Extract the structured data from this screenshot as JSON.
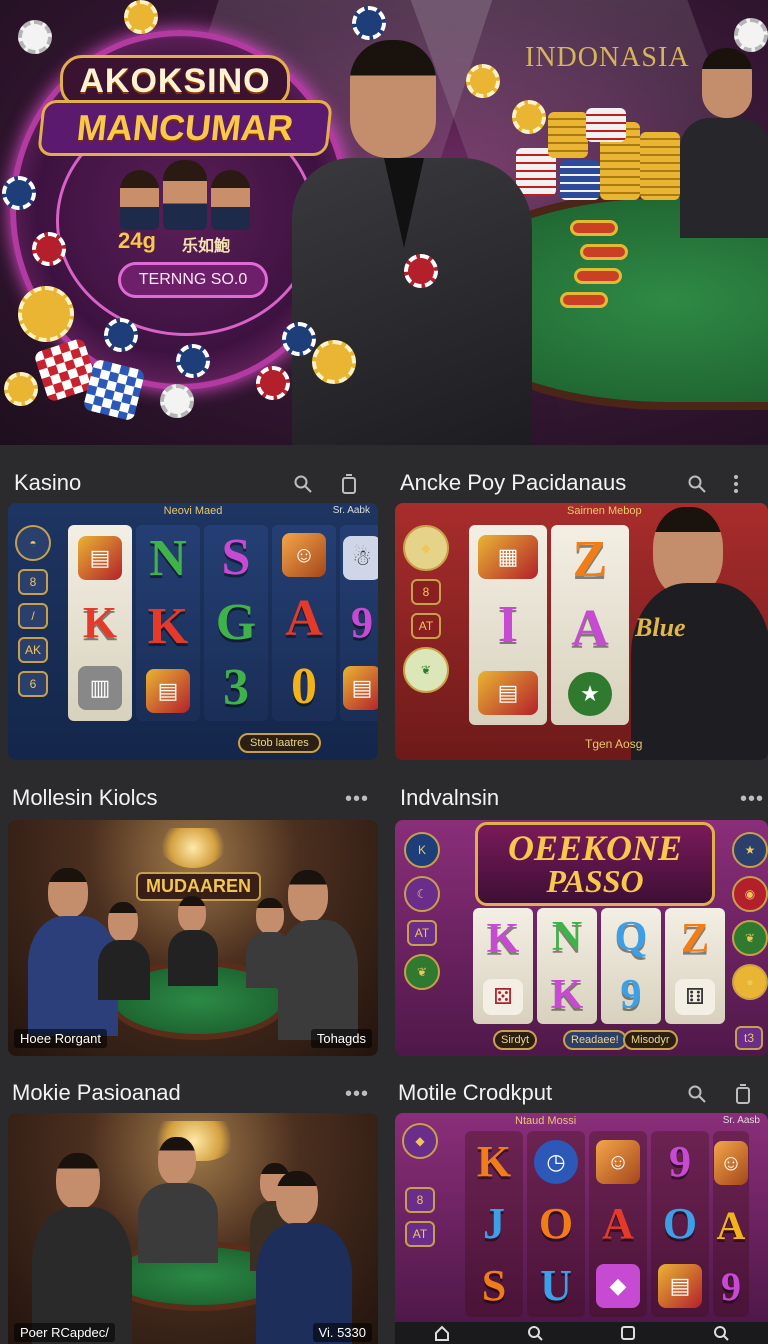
{
  "hero": {
    "logo_line1": "AKOKSINO",
    "logo_line2": "MANCUMAR",
    "number": "24g",
    "subtitle": "乐如鮑",
    "button_label": "TERNNG SO.0",
    "country_label": "INDONASIA"
  },
  "sections": [
    {
      "title": "Kasino",
      "card": {
        "topbar": "Neovi Maed",
        "topright": "Sr. Aabk",
        "pill": "Stob laatres"
      }
    },
    {
      "title": "Ancke Poy Pacidanaus",
      "card": {
        "topbar": "Sairnen Mebop",
        "overlay": "Blue",
        "bottom": "Tgen Aosg"
      }
    },
    {
      "title": "Mollesin Kiolcs",
      "card": {
        "sign": "MUDAAREN",
        "caption_left": "Hoee Rorgant",
        "caption_right": "Tohagds"
      }
    },
    {
      "title": "Indvalnsin",
      "card": {
        "logo1": "OEEKONE",
        "logo2": "PASSO",
        "pill1": "Sirdyt",
        "pill2": "Readaee!",
        "pill3": "Misodyr",
        "corner": "t3"
      }
    },
    {
      "title": "Mokie Pasioanad",
      "card": {
        "caption_left": "Poer RCapdec/",
        "caption_right": "Vi. 5330"
      }
    },
    {
      "title": "Motile Crodkput",
      "card": {
        "topbar": "Ntaud Mossi",
        "topright": "Sr. Aasb"
      }
    }
  ],
  "symbols": {
    "kasino": [
      [
        "N",
        "K",
        "3"
      ],
      [
        "S",
        "G",
        "3"
      ],
      [
        "A",
        "A",
        "0"
      ],
      [
        "9",
        "9",
        ""
      ]
    ],
    "ancke": [
      [
        "Z",
        "I",
        "A"
      ]
    ],
    "indval": [
      "K",
      "N",
      "Q",
      "Z",
      "K",
      "9"
    ],
    "motile": [
      [
        "K",
        "J",
        "S"
      ],
      [
        "O",
        "O",
        "U"
      ],
      [
        "9",
        "A",
        "A"
      ],
      [
        "",
        "O",
        "9"
      ]
    ]
  },
  "side_labels": {
    "kasino": [
      "8",
      "/",
      "AK",
      "6"
    ],
    "ancke": [
      "8",
      "AT"
    ],
    "indval": [
      "K",
      "AT"
    ],
    "motile": [
      "8",
      "AT"
    ]
  },
  "icons": [
    "search-icon",
    "trash-icon",
    "more-vertical-icon",
    "more-horizontal-icon",
    "home-icon",
    "back-icon",
    "recent-icon"
  ]
}
